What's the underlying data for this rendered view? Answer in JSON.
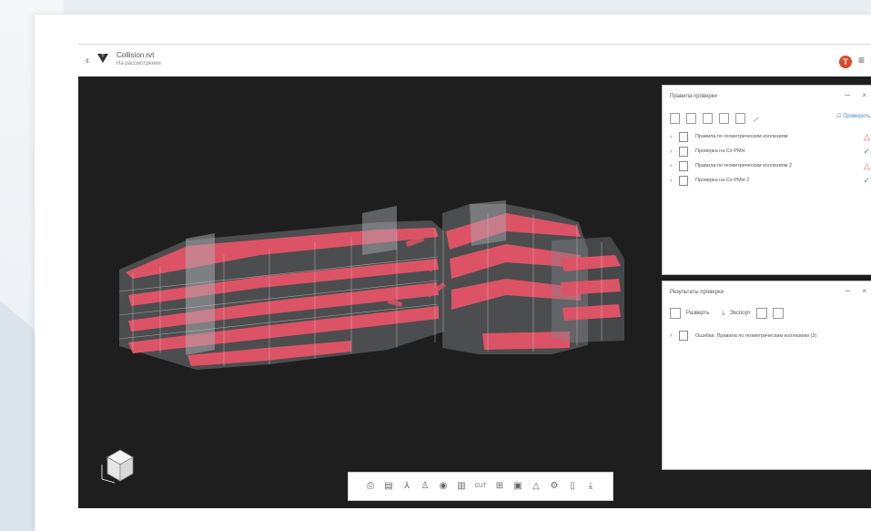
{
  "header": {
    "file_name": "Collision.rvt",
    "file_subtitle": "На рассмотрении",
    "avatar_letter": "T"
  },
  "rules_panel": {
    "title": "Правила проверки",
    "check_button": "Проверить",
    "items": [
      {
        "label": "Правила по геометрическим коллизиям",
        "status": "warning"
      },
      {
        "label": "Проверка на Сх-РМН",
        "status": "ok"
      },
      {
        "label": "Правила по геометрическим коллизиям 2",
        "status": "warning"
      },
      {
        "label": "Проверка на Сх-РМН 2",
        "status": "ok"
      }
    ]
  },
  "results_panel": {
    "title": "Результаты проверки",
    "tool_1": "Разверть",
    "tool_2": "Экспорт",
    "group_label": "Ошибки: Правила по геометрическим коллизиям (3)"
  },
  "toolbar": {
    "icons": [
      "print-icon",
      "layers-icon",
      "axes-icon",
      "person-icon",
      "eye-icon",
      "sheet-icon",
      "cut-icon",
      "section-icon",
      "box-icon",
      "warning-icon",
      "settings-icon",
      "clipboard-icon",
      "download-icon"
    ],
    "cut_label": "CUT"
  },
  "colors": {
    "viewport_bg": "#1e1e1e",
    "highlight": "#e8566a",
    "accent": "#4a88c7",
    "avatar": "#d84a2a"
  }
}
